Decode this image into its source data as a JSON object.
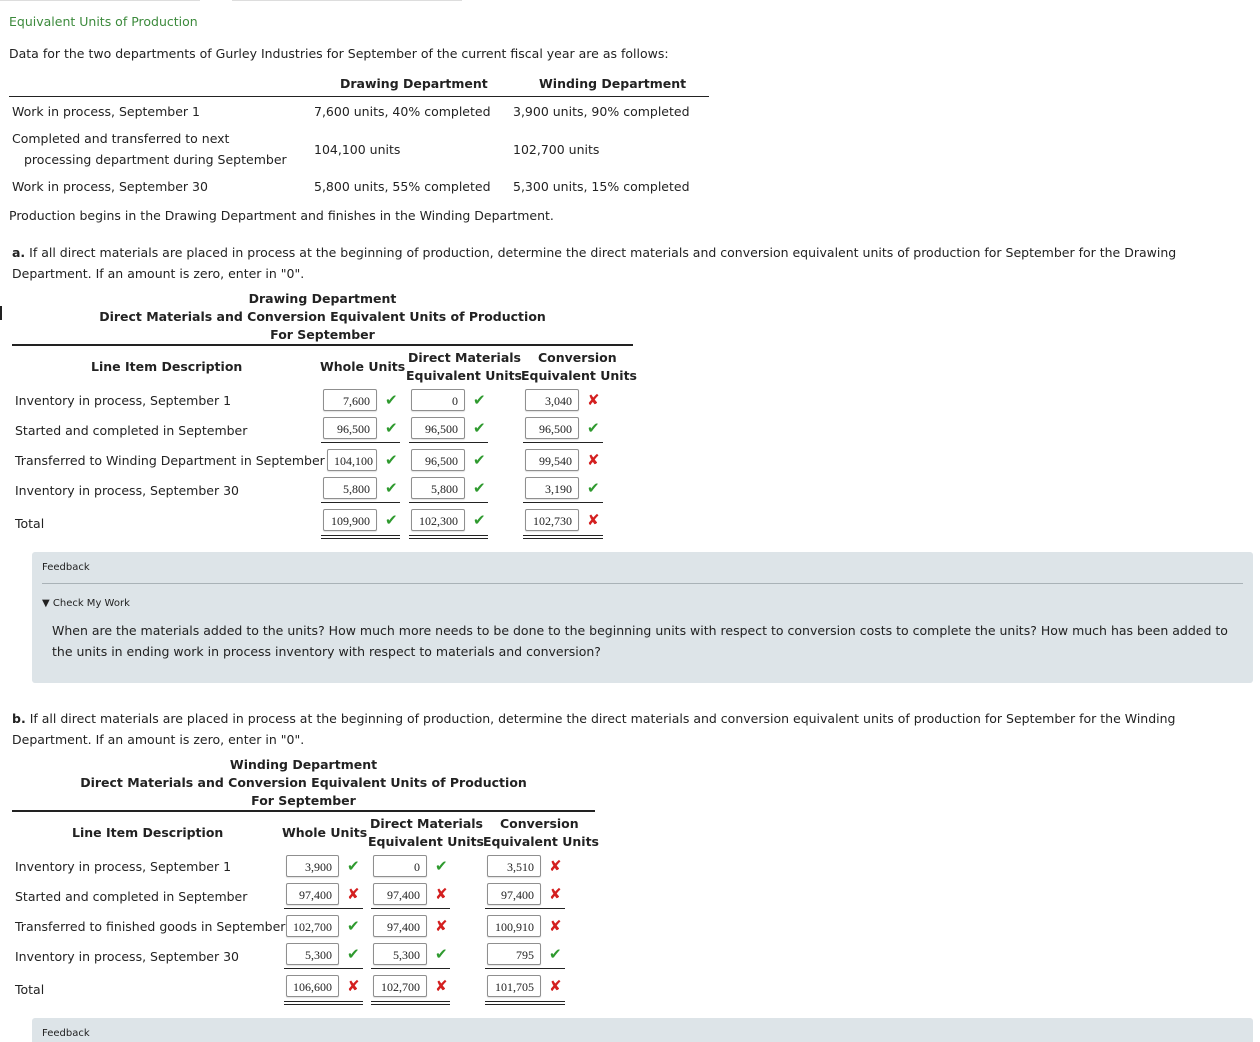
{
  "page": {
    "title": "Equivalent Units of Production",
    "intro": "Data for the two departments of Gurley Industries for September of the current fiscal year are as follows:"
  },
  "data_table": {
    "headers": [
      "Drawing Department",
      "Winding Department"
    ],
    "rows": [
      {
        "label": "Work in process, September 1",
        "drawing": "7,600 units, 40% completed",
        "winding": "3,900 units, 90% completed"
      },
      {
        "label_line1": "Completed and transferred to next",
        "label_line2": "processing department during September",
        "drawing": "104,100 units",
        "winding": "102,700 units"
      },
      {
        "label": "Work in process, September 30",
        "drawing": "5,800 units, 55% completed",
        "winding": "5,300 units, 15% completed"
      }
    ],
    "note": "Production begins in the Drawing Department and finishes in the Winding Department."
  },
  "part_a": {
    "prompt_label": "a.",
    "prompt": "If all direct materials are placed in process at the beginning of production, determine the direct materials and conversion equivalent units of production for September for the Drawing Department. If an amount is zero, enter in \"0\".",
    "title1": "Drawing Department",
    "title2": "Direct Materials and Conversion Equivalent Units of Production",
    "title3": "For September",
    "col_desc": "Line Item Description",
    "col_whole": "Whole Units",
    "col_dm1": "Direct Materials",
    "col_dm2": "Equivalent Units",
    "col_conv1": "Conversion",
    "col_conv2": "Equivalent Units",
    "rows": [
      {
        "label": "Inventory in process, September 1",
        "whole": "7,600",
        "whole_ok": "✔",
        "dm": "0",
        "dm_ok": "✔",
        "conv": "3,040",
        "conv_ok": "✘"
      },
      {
        "label": "Started and completed in September",
        "whole": "96,500",
        "whole_ok": "✔",
        "dm": "96,500",
        "dm_ok": "✔",
        "conv": "96,500",
        "conv_ok": "✔"
      },
      {
        "label": "Transferred to Winding Department in September",
        "whole": "104,100",
        "whole_ok": "✔",
        "dm": "96,500",
        "dm_ok": "✔",
        "conv": "99,540",
        "conv_ok": "✘"
      },
      {
        "label": "Inventory in process, September 30",
        "whole": "5,800",
        "whole_ok": "✔",
        "dm": "5,800",
        "dm_ok": "✔",
        "conv": "3,190",
        "conv_ok": "✔"
      },
      {
        "label": "Total",
        "whole": "109,900",
        "whole_ok": "✔",
        "dm": "102,300",
        "dm_ok": "✔",
        "conv": "102,730",
        "conv_ok": "✘"
      }
    ],
    "feedback_label": "Feedback",
    "check_label": "▼ Check My Work",
    "feedback_text": "When are the materials added to the units? How much more needs to be done to the beginning units with respect to conversion costs to complete the units? How much has been added to the units in ending work in process inventory with respect to materials and conversion?"
  },
  "part_b": {
    "prompt_label": "b.",
    "prompt": "If all direct materials are placed in process at the beginning of production, determine the direct materials and conversion equivalent units of production for September for the Winding Department. If an amount is zero, enter in \"0\".",
    "title1": "Winding Department",
    "title2": "Direct Materials and Conversion Equivalent Units of Production",
    "title3": "For September",
    "col_desc": "Line Item Description",
    "col_whole": "Whole Units",
    "col_dm1": "Direct Materials",
    "col_dm2": "Equivalent Units",
    "col_conv1": "Conversion",
    "col_conv2": "Equivalent Units",
    "rows": [
      {
        "label": "Inventory in process, September 1",
        "whole": "3,900",
        "whole_ok": "✔",
        "dm": "0",
        "dm_ok": "✔",
        "conv": "3,510",
        "conv_ok": "✘"
      },
      {
        "label": "Started and completed in September",
        "whole": "97,400",
        "whole_ok": "✘",
        "dm": "97,400",
        "dm_ok": "✘",
        "conv": "97,400",
        "conv_ok": "✘"
      },
      {
        "label": "Transferred to finished goods in September",
        "whole": "102,700",
        "whole_ok": "✔",
        "dm": "97,400",
        "dm_ok": "✘",
        "conv": "100,910",
        "conv_ok": "✘"
      },
      {
        "label": "Inventory in process, September 30",
        "whole": "5,300",
        "whole_ok": "✔",
        "dm": "5,300",
        "dm_ok": "✔",
        "conv": "795",
        "conv_ok": "✔"
      },
      {
        "label": "Total",
        "whole": "106,600",
        "whole_ok": "✘",
        "dm": "102,700",
        "dm_ok": "✘",
        "conv": "101,705",
        "conv_ok": "✘"
      }
    ],
    "feedback_label": "Feedback"
  },
  "colors": {
    "ok": "#2f9a2f",
    "bad": "#d42020",
    "title": "#3c8a3c",
    "feedback_bg": "#dde4e8"
  }
}
